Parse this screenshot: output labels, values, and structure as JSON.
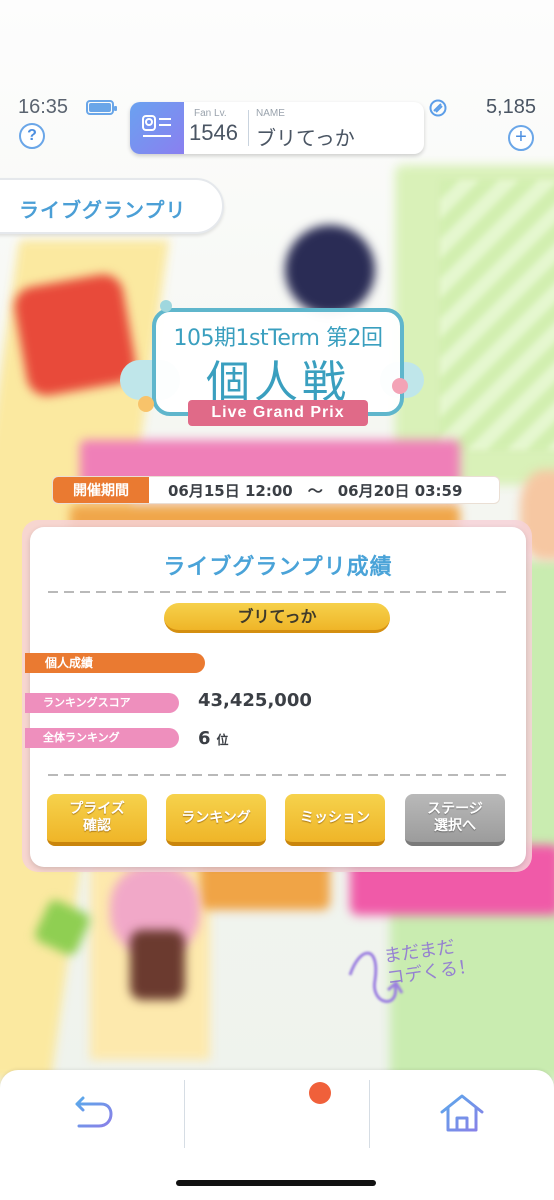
{
  "status": {
    "time": "16:35",
    "battery_level": 1.0
  },
  "header": {
    "help_label": "?",
    "fan_level_label": "Fan Lv.",
    "fan_level_value": "1546",
    "name_label": "NAME",
    "name_value": "ブリてっか",
    "gem_count": "5,185",
    "add_label": "+"
  },
  "section_tab": {
    "label": "ライブグランプリ"
  },
  "event_logo": {
    "line1": "105期1stTerm 第2回",
    "line2": "個人戦",
    "ribbon": "Live Grand Prix"
  },
  "period": {
    "label": "開催期間",
    "value": "06月15日 12:00　～　06月20日 03:59"
  },
  "results": {
    "title": "ライブグランプリ成績",
    "player_name": "ブリてっか",
    "section_label": "個人成績",
    "score_label": "ランキングスコア",
    "score_value": "43,425,000",
    "rank_label": "全体ランキング",
    "rank_value": "6",
    "rank_unit": "位",
    "buttons": {
      "prize": "プライズ\n確認",
      "ranking": "ランキング",
      "mission": "ミッション",
      "stage": "ステージ\n選択へ"
    }
  },
  "background": {
    "scribble_text": "まだまだ\nコデくる！"
  },
  "bottom_nav": {
    "items": [
      "back-icon",
      "menu-icon",
      "home-icon"
    ],
    "menu_has_badge": true
  },
  "colors": {
    "accent_blue": "#4aa3d8",
    "orange": "#ea7a31",
    "pink": "#ee8fbd",
    "gold": "#efb528",
    "badge": "#f0603a"
  }
}
